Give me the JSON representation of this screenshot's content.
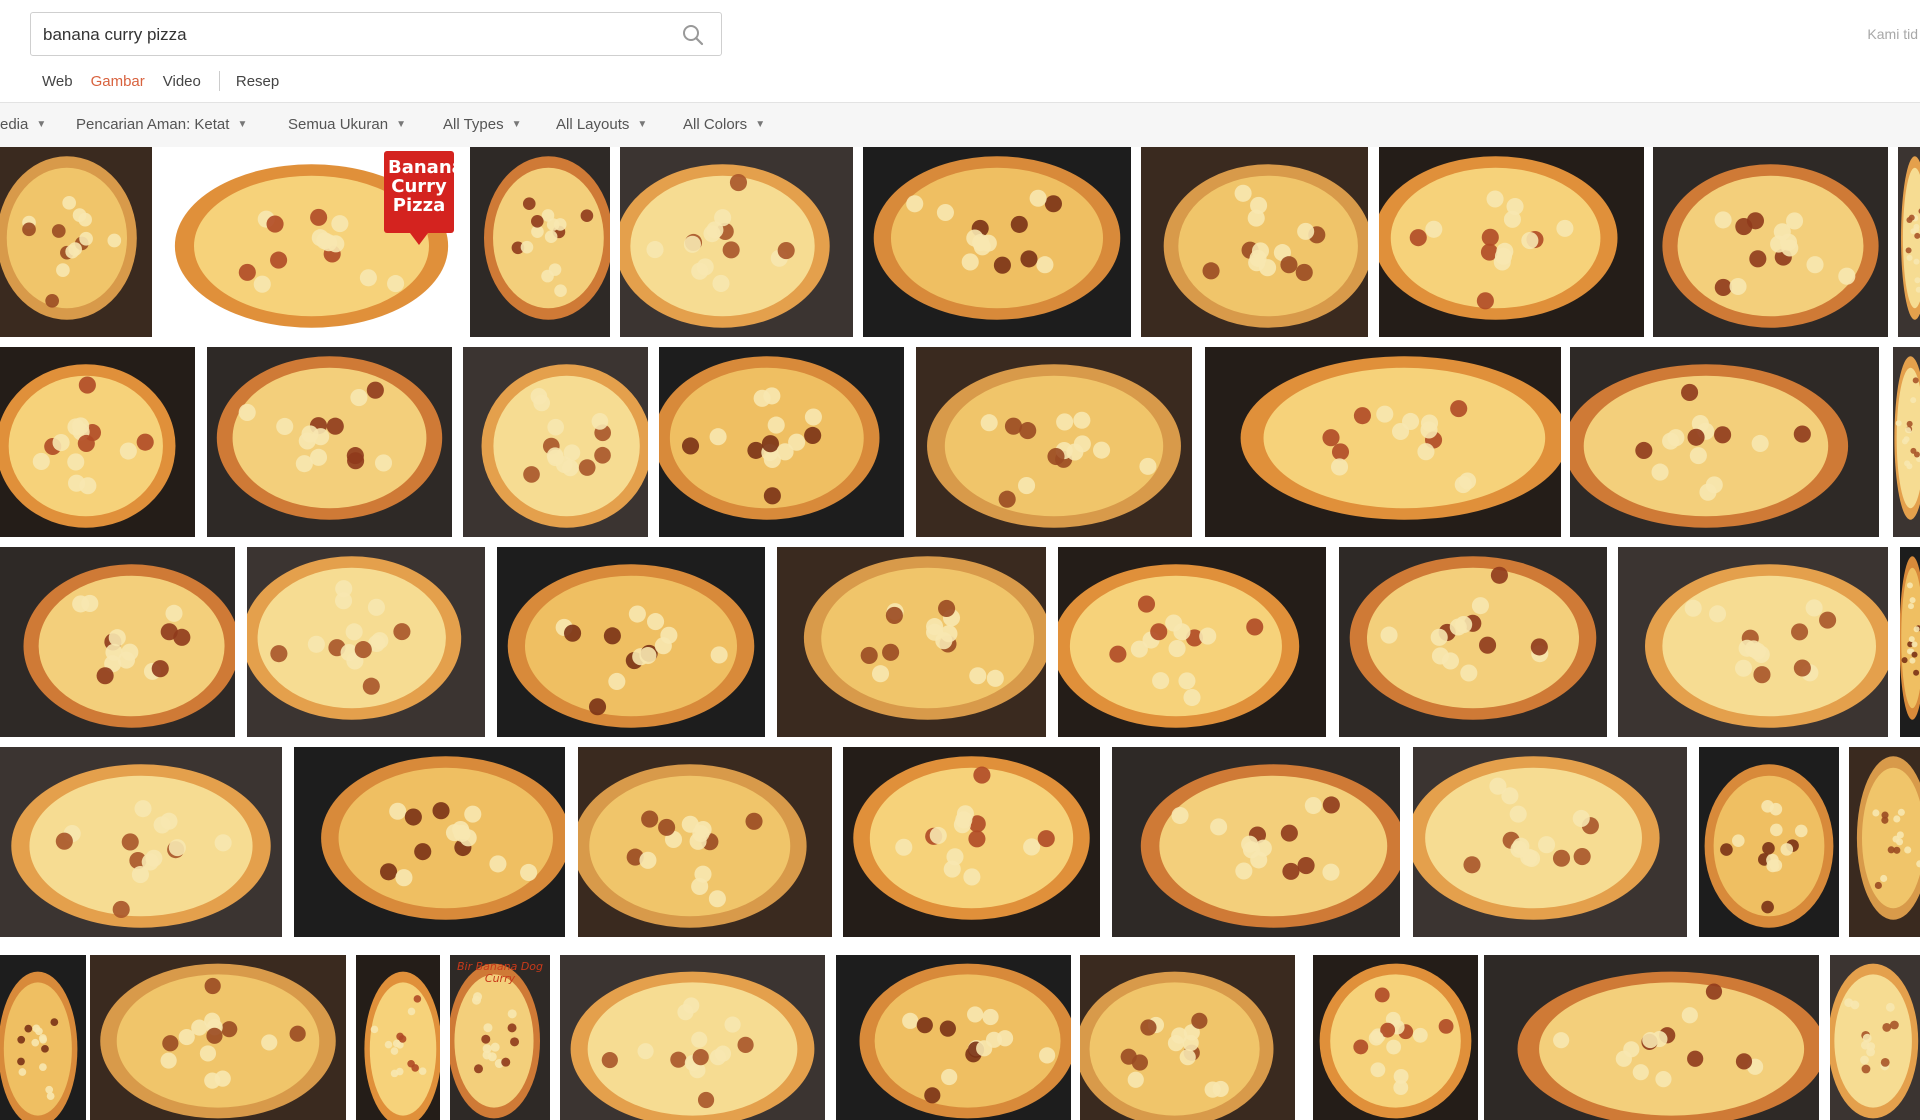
{
  "search": {
    "query": "banana curry pizza"
  },
  "header": {
    "account_text": "Kami tid"
  },
  "nav": {
    "tabs": [
      "Web",
      "Gambar",
      "Video",
      "Resep"
    ],
    "active": "Gambar"
  },
  "filters": [
    "edia",
    "Pencarian Aman: Ketat",
    "Semua Ukuran",
    "All Types",
    "All Layouts",
    "All Colors"
  ],
  "results": {
    "promo_text": "Banana Curry Pizza",
    "thumb_caption": "Bir Banana Dog Curry"
  },
  "colors": {
    "accent": "#d8623e",
    "border": "#cfcfcf",
    "filter_bg": "#f6f6f6"
  },
  "icons": {
    "search": "search-icon",
    "caret": "caret-down-icon"
  }
}
